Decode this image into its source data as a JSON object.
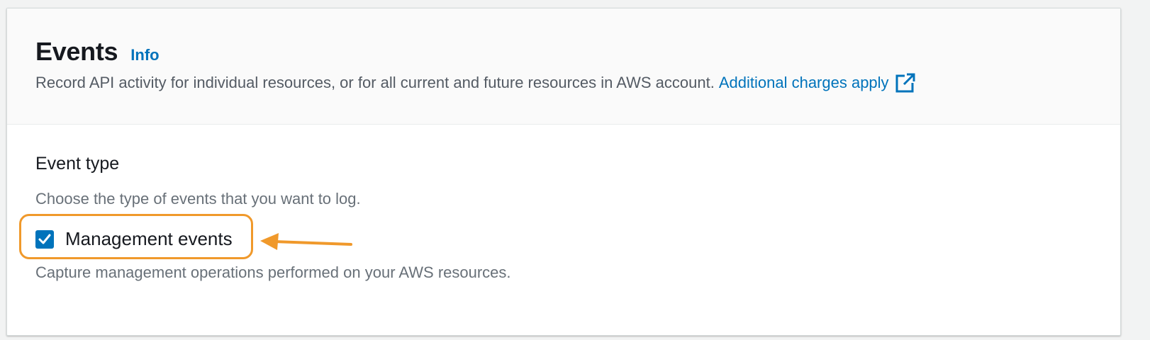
{
  "panel": {
    "title": "Events",
    "info_label": "Info",
    "description": "Record API activity for individual resources, or for all current and future resources in AWS account.",
    "charges_link": "Additional charges apply",
    "external_icon": "external-link-icon"
  },
  "event_type": {
    "heading": "Event type",
    "description": "Choose the type of events that you want to log.",
    "management": {
      "label": "Management events",
      "checked": true,
      "description": "Capture management operations performed on your AWS resources."
    }
  },
  "annotation": {
    "highlight_color": "#f0992b",
    "arrow_icon": "arrow-left-icon"
  },
  "colors": {
    "link": "#0073bb",
    "title": "#16191f",
    "secondary_text": "#687078",
    "checkbox": "#0073bb"
  }
}
